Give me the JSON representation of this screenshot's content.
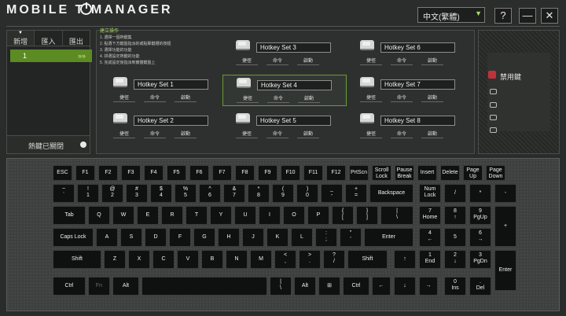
{
  "app": {
    "logo_text": "MOBILE  T MANAGER",
    "language": "中文(繁體)",
    "help_label": "?",
    "minimize_label": "—",
    "close_label": "✕"
  },
  "left_panel": {
    "tabs": [
      {
        "label": "新增"
      },
      {
        "label": "匯入"
      },
      {
        "label": "匯出"
      }
    ],
    "set_item": "1",
    "set_chevron": "»»",
    "hotkey_toggle_label": "熱鍵已關閉"
  },
  "instructions": {
    "title": "建立操作",
    "lines": [
      "1. 選擇一個熱鍵集",
      "2. 點選下方鍵盤指派的或點擊鍵槽的按鈕",
      "3. 選擇功能的功能",
      "4. 拼選設定熱鍵的功能",
      "5. 完成設定後指派到實體鍵盤上"
    ]
  },
  "hotkey_sets": [
    {
      "name": "Hotkey Set 1",
      "selected": false
    },
    {
      "name": "Hotkey Set 2",
      "selected": false
    },
    {
      "name": "Hotkey Set 3",
      "selected": false
    },
    {
      "name": "Hotkey Set 4",
      "selected": true
    },
    {
      "name": "Hotkey Set 5",
      "selected": false
    },
    {
      "name": "Hotkey Set 6",
      "selected": false
    },
    {
      "name": "Hotkey Set 7",
      "selected": false
    },
    {
      "name": "Hotkey Set 8",
      "selected": false
    }
  ],
  "hotkey_buttons": [
    "捷徑",
    "命令",
    "啟動"
  ],
  "right_panel": {
    "disabled_label": "禁用鍵"
  },
  "keyboard": {
    "row1": [
      "ESC",
      "F1",
      "F2",
      "F3",
      "F4",
      "F5",
      "F6",
      "F7",
      "F8",
      "F9",
      "F10",
      "F11",
      "F12",
      "PrtScn",
      "Scroll\nLock",
      "Pause\nBreak",
      "Insert",
      "Delete",
      "Page\nUp",
      "Page\nDown"
    ],
    "row2": [
      "~\n`",
      "!\n1",
      "@\n2",
      "#\n3",
      "$\n4",
      "%\n5",
      "^\n6",
      "&\n7",
      "*\n8",
      "(\n9",
      ")\n0",
      "_\n-",
      "+\n=",
      "Backspace",
      "Num\nLock",
      "/",
      "*",
      "-"
    ],
    "row3": [
      "Tab",
      "Q",
      "W",
      "E",
      "R",
      "T",
      "Y",
      "U",
      "I",
      "O",
      "P",
      "{\n[",
      "}\n]",
      "|\n\\",
      "7\nHome",
      "8\n↑",
      "9\nPgUp",
      "+"
    ],
    "row4": [
      "Caps Lock",
      "A",
      "S",
      "D",
      "F",
      "G",
      "H",
      "J",
      "K",
      "L",
      ":\n;",
      "\"\n'",
      "Enter",
      "4\n←",
      "5",
      "6\n→"
    ],
    "row5": [
      "Shift",
      "Z",
      "X",
      "C",
      "V",
      "B",
      "N",
      "M",
      "<\n,",
      ">\n.",
      "?\n/",
      "Shift",
      "↑",
      "1\nEnd",
      "2\n↓",
      "3\nPgDn",
      "Enter"
    ],
    "row6": [
      "Ctrl",
      "Fn",
      "Alt",
      "",
      "|\n\\",
      "Alt",
      "⊞",
      "Ctrl",
      "←",
      "↓",
      "→",
      "0\nIns",
      ".\nDel"
    ]
  }
}
